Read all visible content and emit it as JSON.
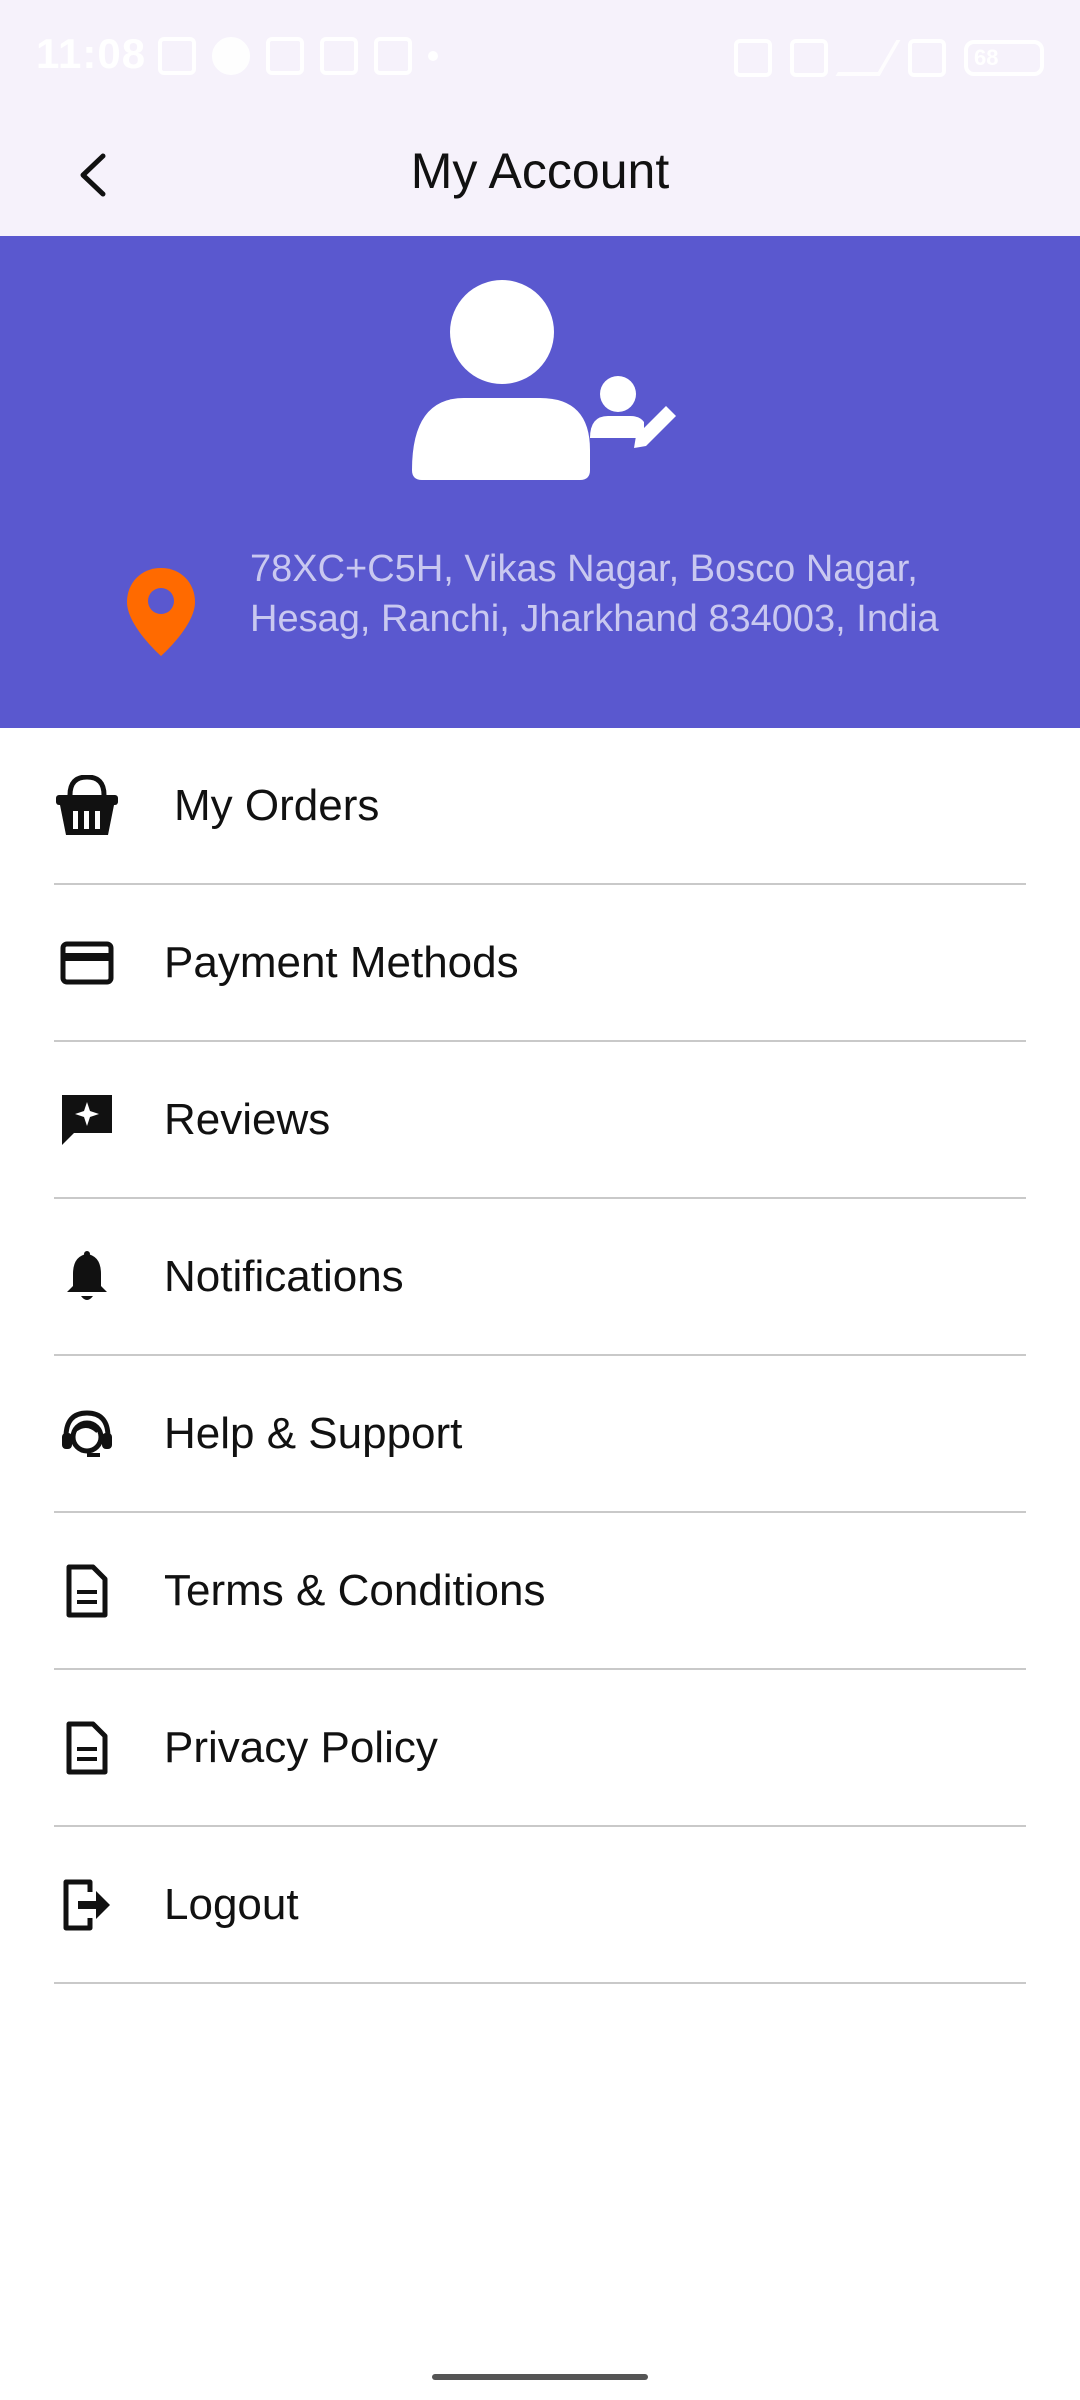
{
  "status_bar": {
    "time": "11:08",
    "battery": "68"
  },
  "app_bar": {
    "title": "My Account",
    "back_icon": "chevron-left-icon"
  },
  "profile": {
    "avatar_icon": "user-edit-icon",
    "location_icon": "map-pin-icon",
    "address": "78XC+C5H, Vikas Nagar, Bosco Nagar, Hesag, Ranchi, Jharkhand 834003, India"
  },
  "menu": {
    "items": [
      {
        "label": "My Orders",
        "icon": "basket-icon"
      },
      {
        "label": "Payment Methods",
        "icon": "credit-card-icon"
      },
      {
        "label": "Reviews",
        "icon": "review-icon"
      },
      {
        "label": "Notifications",
        "icon": "bell-icon"
      },
      {
        "label": "Help & Support",
        "icon": "headset-icon"
      },
      {
        "label": "Terms & Conditions",
        "icon": "document-icon"
      },
      {
        "label": "Privacy Policy",
        "icon": "document-icon"
      },
      {
        "label": "Logout",
        "icon": "logout-icon"
      }
    ]
  },
  "colors": {
    "header_bg": "#5a58cf",
    "pin": "#ff6a00",
    "appbar_bg": "#f6f2fb"
  }
}
